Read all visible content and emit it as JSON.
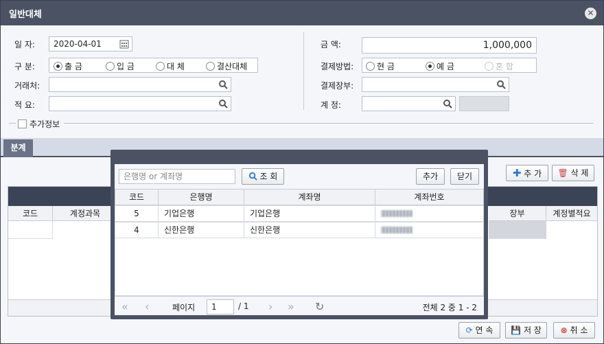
{
  "window": {
    "title": "일반대체"
  },
  "form": {
    "date_label": "일   자:",
    "date_value": "2020-04-01",
    "type_label": "구   분:",
    "type_options": [
      "출 금",
      "입 금",
      "대 체",
      "결산대체"
    ],
    "type_selected": "출 금",
    "client_label": "거래처:",
    "client_value": "",
    "summary_label": "적   요:",
    "summary_value": "",
    "amount_label": "금        액:",
    "amount_value": "1,000,000",
    "pay_method_label": "결제방법:",
    "pay_method_options": [
      "현 금",
      "예 금",
      "혼 합"
    ],
    "pay_method_selected": "예 금",
    "pay_ledger_label": "결제장부:",
    "pay_ledger_value": "",
    "account_label": "계   정:",
    "account_value": "",
    "extra_info_label": "추가정보"
  },
  "tabs": {
    "split": "분계"
  },
  "grid_buttons": {
    "add": "추 가",
    "delete": "삭 제"
  },
  "grid": {
    "columns": [
      "코드",
      "계정과목",
      "장부",
      "계정별적요"
    ]
  },
  "bottom_buttons": {
    "continuous": "연 속",
    "save": "저 장",
    "cancel": "취 소"
  },
  "modal": {
    "search_placeholder": "은행명 or 계좌명",
    "search_button": "조 회",
    "add_button": "추가",
    "close_button": "닫기",
    "columns": [
      "코드",
      "은행명",
      "계좌명",
      "계좌번호"
    ],
    "rows": [
      {
        "code": "5",
        "bank": "기업은행",
        "account_name": "기업은행"
      },
      {
        "code": "4",
        "bank": "신한은행",
        "account_name": "신한은행"
      }
    ],
    "pager": {
      "page_label": "페이지",
      "page_value": "1",
      "page_total": "/ 1",
      "summary": "전체 2 중 1 - 2"
    }
  },
  "colors": {
    "titlebar": "#4a5263",
    "accent_blue": "#2b7bd0",
    "cancel_red": "#d43a2f"
  }
}
